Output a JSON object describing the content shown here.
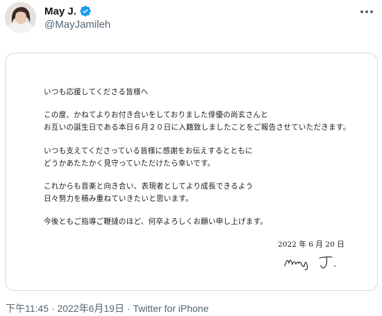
{
  "author": {
    "display_name": "May J.",
    "handle": "@MayJamileh"
  },
  "letter": {
    "lines": [
      "いつも応援してくださる皆様へ",
      "",
      "この度、かねてよりお付き合いをしておりました俳優の尚玄さんと",
      "お互いの誕生日である本日６月２０日に入籍致しましたことをご報告させていただきます。",
      "",
      "いつも支えてくださっている皆様に感謝をお伝えするとともに",
      "どうかあたたかく見守っていただけたら幸いです。",
      "",
      "これからも音楽と向き合い、表現者としてより成長できるよう",
      "日々努力を積み重ねていきたいと思います。",
      "",
      "今後ともご指導ご鞭撻のほど、何卒よろしくお願い申し上げます。"
    ],
    "date": "2022 年 6 月 20 日",
    "signature": "May J."
  },
  "meta": {
    "time": "下午11:45",
    "separator1": " · ",
    "date": "2022年6月19日",
    "separator2": " · ",
    "source": "Twitter for iPhone"
  },
  "colors": {
    "verified": "#1d9bf0",
    "secondary_text": "#536471"
  }
}
